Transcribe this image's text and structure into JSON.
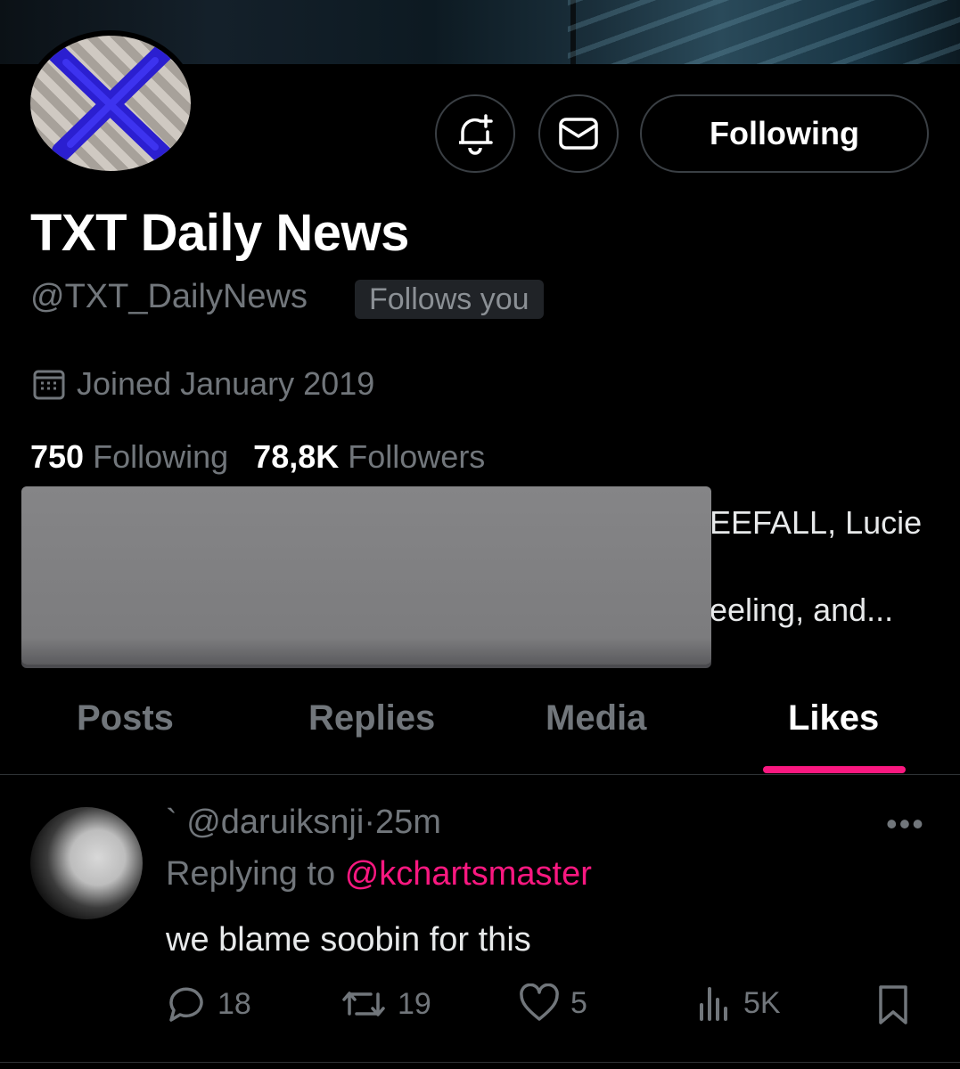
{
  "profile": {
    "name": "TXT Daily News",
    "handle": "@TXT_DailyNews",
    "follows_you": "Follows you",
    "joined": "Joined January 2019",
    "following_count": "750",
    "following_label": "Following",
    "followers_count": "78,8K",
    "followers_label": "Followers",
    "bio_line1_visible": "EEFALL, Lucie",
    "bio_line2_visible": "eeling, and..."
  },
  "actions": {
    "following_button": "Following"
  },
  "tabs": [
    {
      "label": "Posts"
    },
    {
      "label": "Replies"
    },
    {
      "label": "Media"
    },
    {
      "label": "Likes"
    }
  ],
  "active_tab": "Likes",
  "post": {
    "display_prefix": "`",
    "handle": "@daruiksnji",
    "separator": "·",
    "time": "25m",
    "replying_label": "Replying to",
    "replying_to": "@kchartsmaster",
    "text": "we blame soobin for this",
    "replies": "18",
    "reposts": "19",
    "likes": "5",
    "views": "5K"
  },
  "colors": {
    "accent": "#f91880",
    "muted": "#71767b",
    "background": "#000000"
  }
}
